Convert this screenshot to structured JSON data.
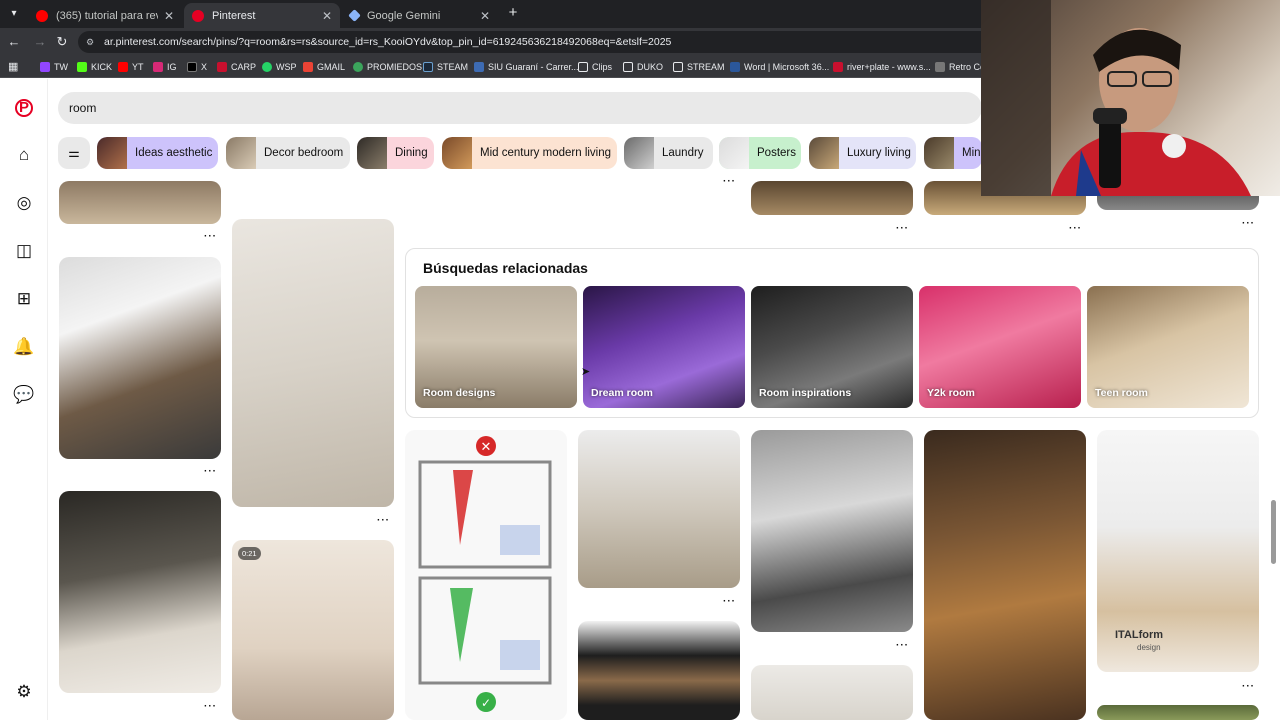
{
  "browser": {
    "tabs": [
      {
        "label": "(365) tutorial para revivir a tu h",
        "favicon": "youtube-icon",
        "color": "#ff0000"
      },
      {
        "label": "Pinterest",
        "favicon": "pinterest-icon",
        "color": "#e60023"
      },
      {
        "label": "Google Gemini",
        "favicon": "gemini-icon",
        "color": "#8ab4f8"
      }
    ],
    "url": "ar.pinterest.com/search/pins/?q=room&rs=rs&source_id=rs_KooiOYdv&top_pin_id=619245636218492068eq=&etslf=2025",
    "bookmarks": [
      {
        "label": "TW",
        "color": "#9146ff"
      },
      {
        "label": "KICK",
        "color": "#53fc18"
      },
      {
        "label": "YT",
        "color": "#ff0000"
      },
      {
        "label": "IG",
        "color": "#d62976"
      },
      {
        "label": "X",
        "color": "#000000"
      },
      {
        "label": "CARP",
        "color": "#e8eaed"
      },
      {
        "label": "WSP",
        "color": "#25d366"
      },
      {
        "label": "GMAIL",
        "color": "#ea4335"
      },
      {
        "label": "PROMIEDOS",
        "color": "#3ba55c"
      },
      {
        "label": "STEAM",
        "color": "#1b2838"
      },
      {
        "label": "SIU Guaraní - Carrer...",
        "color": "#3d6bb3"
      },
      {
        "label": "Clips",
        "color": "#e8eaed"
      },
      {
        "label": "DUKO",
        "color": "#e8eaed"
      },
      {
        "label": "STREAM",
        "color": "#e8eaed"
      },
      {
        "label": "Word | Microsoft 36...",
        "color": "#2b579a"
      },
      {
        "label": "river+plate - www.s...",
        "color": "#c8102e"
      },
      {
        "label": "Retro Co",
        "color": "#777777"
      }
    ]
  },
  "search": {
    "query": "room"
  },
  "chips": [
    {
      "label": "Ideas aesthetic",
      "color": "#cdc3fb"
    },
    {
      "label": "Decor bedroom",
      "color": "#e9e9e9"
    },
    {
      "label": "Dining",
      "color": "#fbd5dc"
    },
    {
      "label": "Mid century modern living",
      "color": "#fce3d2"
    },
    {
      "label": "Laundry",
      "color": "#e9e9e9"
    },
    {
      "label": "Posters",
      "color": "#c7f0cd"
    },
    {
      "label": "Luxury living",
      "color": "#e4e4f8"
    },
    {
      "label": "Mini",
      "color": "#cdc3fb"
    }
  ],
  "related": {
    "title": "Búsquedas relacionadas",
    "items": [
      {
        "label": "Room designs"
      },
      {
        "label": "Dream room"
      },
      {
        "label": "Room inspirations"
      },
      {
        "label": "Y2k room"
      },
      {
        "label": "Teen room"
      }
    ]
  },
  "pins": {
    "video_duration": "0:21",
    "brand_text": "ITALform",
    "brand_sub": "design"
  },
  "more_label": "···"
}
